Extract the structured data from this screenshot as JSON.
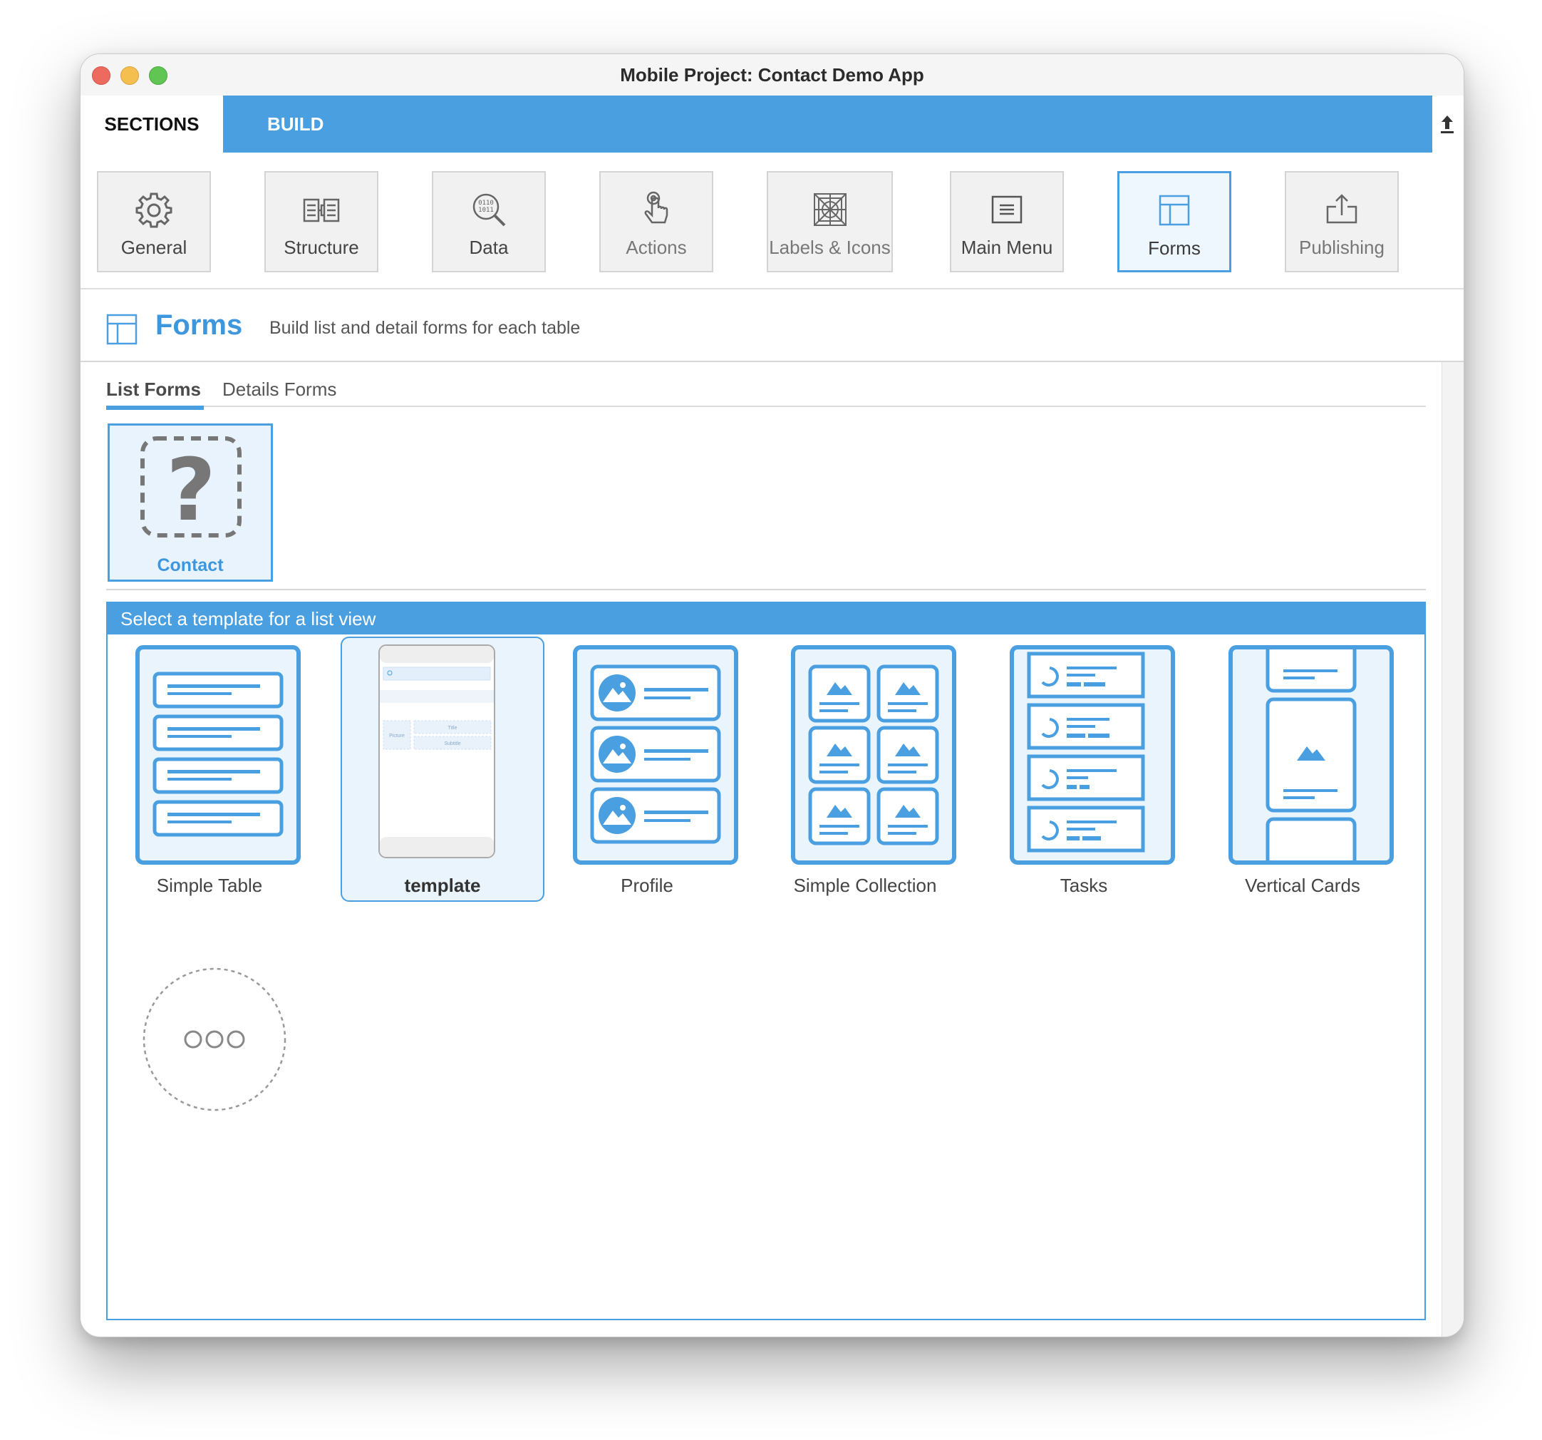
{
  "window": {
    "title": "Mobile Project: Contact Demo App"
  },
  "top_tabs": {
    "sections": "SECTIONS",
    "build": "BUILD"
  },
  "toolbar": {
    "general": "General",
    "structure": "Structure",
    "data": "Data",
    "actions": "Actions",
    "labels_icons": "Labels & Icons",
    "main_menu": "Main Menu",
    "forms": "Forms",
    "publishing": "Publishing"
  },
  "header": {
    "title": "Forms",
    "description": "Build list and detail forms for each table"
  },
  "subtabs": {
    "list": "List Forms",
    "details": "Details Forms"
  },
  "tables": [
    {
      "label": "Contact"
    }
  ],
  "template_panel": {
    "header": "Select a template for a list view",
    "templates": [
      {
        "label": "Simple Table"
      },
      {
        "label": "template",
        "selected": true
      },
      {
        "label": "Profile"
      },
      {
        "label": "Simple Collection"
      },
      {
        "label": "Tasks"
      },
      {
        "label": "Vertical Cards"
      }
    ],
    "template_preview": {
      "title": "Title",
      "subtitle": "Subtitle",
      "picture": "Picture"
    }
  },
  "colors": {
    "accent": "#4a9fe0",
    "accent_light": "#eaf4fd",
    "toolbar_bg": "#f1f1f1"
  },
  "icons": [
    "gear-icon",
    "structure-icon",
    "data-search-icon",
    "tap-icon",
    "labels-icons-icon",
    "menu-icon",
    "forms-icon",
    "publish-icon",
    "upload-icon",
    "question-icon",
    "more-icon"
  ]
}
